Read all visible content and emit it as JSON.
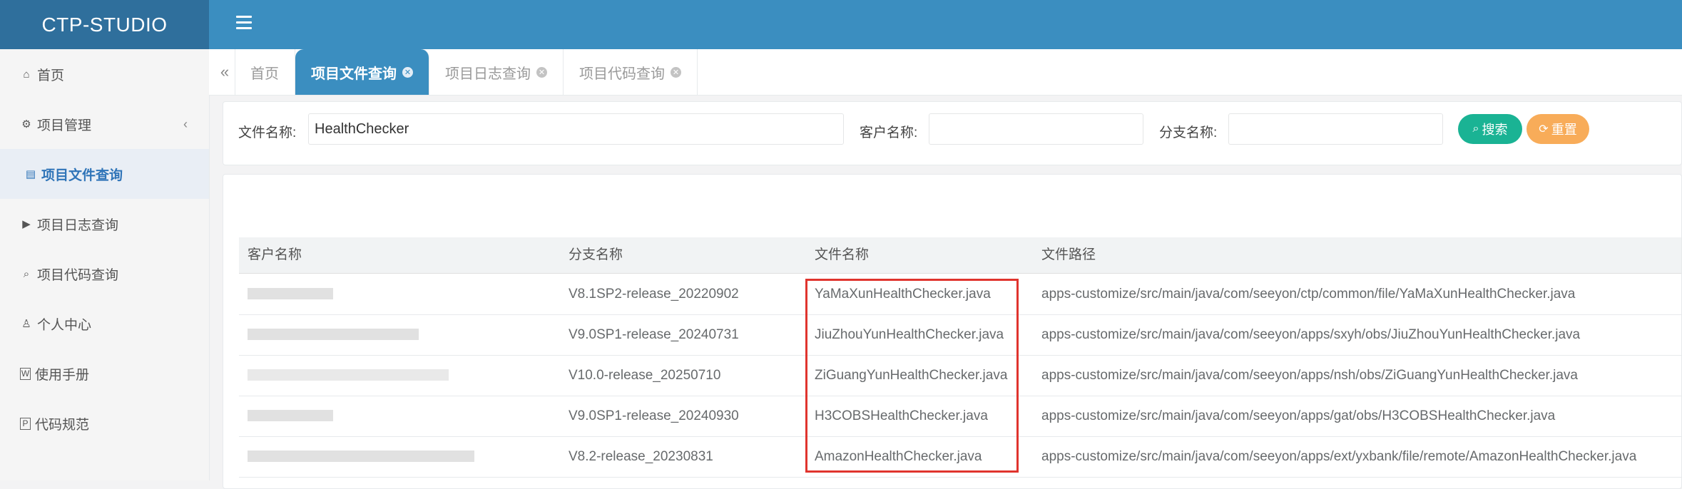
{
  "app": {
    "title": "CTP-STUDIO"
  },
  "sidebar": {
    "items": [
      {
        "label": "首页",
        "icon": "home-icon",
        "glyph": "⌂"
      },
      {
        "label": "项目管理",
        "icon": "gear-icon",
        "glyph": "⚙"
      },
      {
        "label": "项目文件查询",
        "icon": "archive-icon",
        "glyph": "▤",
        "active": true
      },
      {
        "label": "项目日志查询",
        "icon": "play-box-icon",
        "glyph": "▶"
      },
      {
        "label": "项目代码查询",
        "icon": "search-icon",
        "glyph": "⌕"
      },
      {
        "label": "个人中心",
        "icon": "person-icon",
        "glyph": "♙"
      },
      {
        "label": "使用手册",
        "icon": "word-doc-icon",
        "glyph": "W"
      },
      {
        "label": "代码规范",
        "icon": "file-text-icon",
        "glyph": "P"
      }
    ],
    "collapse_arrow": "‹"
  },
  "tabs": [
    {
      "label": "首页"
    },
    {
      "label": "项目文件查询",
      "active": true
    },
    {
      "label": "项目日志查询"
    },
    {
      "label": "项目代码查询"
    }
  ],
  "search": {
    "file_label": "文件名称:",
    "file_value": "HealthChecker",
    "customer_label": "客户名称:",
    "customer_value": "",
    "branch_label": "分支名称:",
    "branch_value": "",
    "search_button": "搜索",
    "reset_button": "重置"
  },
  "table": {
    "headers": [
      "客户名称",
      "分支名称",
      "文件名称",
      "文件路径"
    ],
    "rows": [
      {
        "branch": "V8.1SP2-release_20220902",
        "file": "YaMaXunHealthChecker.java",
        "path": "apps-customize/src/main/java/com/seeyon/ctp/common/file/YaMaXunHealthChecker.java"
      },
      {
        "branch": "V9.0SP1-release_20240731",
        "file": "JiuZhouYunHealthChecker.java",
        "path": "apps-customize/src/main/java/com/seeyon/apps/sxyh/obs/JiuZhouYunHealthChecker.java"
      },
      {
        "branch": "V10.0-release_20250710",
        "file": "ZiGuangYunHealthChecker.java",
        "path": "apps-customize/src/main/java/com/seeyon/apps/nsh/obs/ZiGuangYunHealthChecker.java"
      },
      {
        "branch": "V9.0SP1-release_20240930",
        "file": "H3COBSHealthChecker.java",
        "path": "apps-customize/src/main/java/com/seeyon/apps/gat/obs/H3COBSHealthChecker.java"
      },
      {
        "branch": "V8.2-release_20230831",
        "file": "AmazonHealthChecker.java",
        "path": "apps-customize/src/main/java/com/seeyon/apps/ext/yxbank/file/remote/AmazonHealthChecker.java"
      }
    ]
  },
  "colors": {
    "header": "#3b8ec0",
    "logo_bg": "#2f6f9c",
    "search_btn": "#1ab394",
    "reset_btn": "#f8ac59",
    "highlight": "#e0342e"
  }
}
